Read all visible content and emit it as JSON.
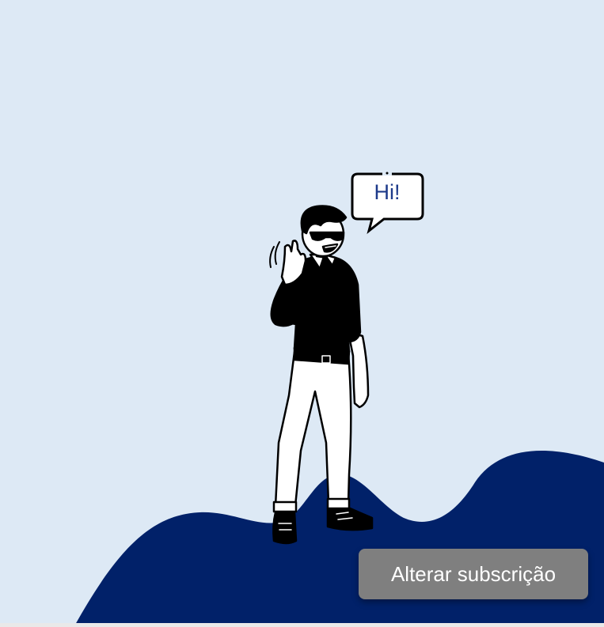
{
  "speech_bubble": {
    "text": "Hi!"
  },
  "subscription_button": {
    "label": "Alterar subscrição"
  },
  "colors": {
    "background": "#dde9f5",
    "wave": "#012169",
    "button": "#7f7f7f",
    "button_text": "#ffffff",
    "bubble_text": "#1d3a8a"
  }
}
